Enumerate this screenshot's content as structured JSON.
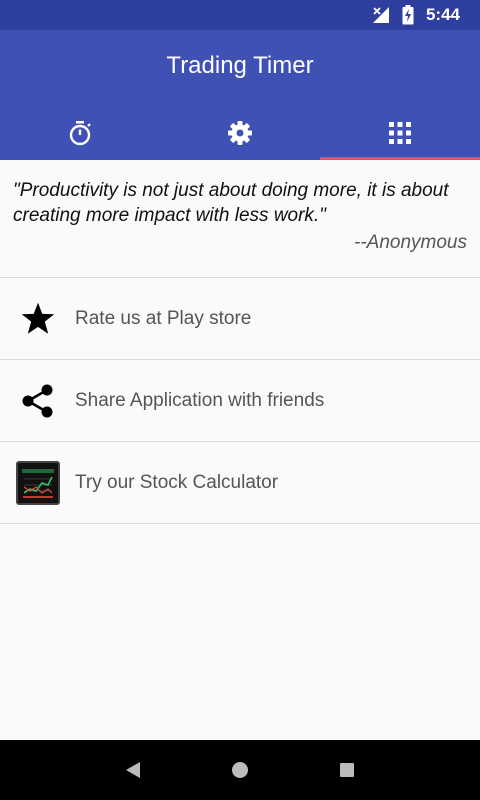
{
  "status_bar": {
    "time": "5:44"
  },
  "app_bar": {
    "title": "Trading Timer"
  },
  "tabs": [
    {
      "name": "timer",
      "icon": "stopwatch-icon"
    },
    {
      "name": "settings",
      "icon": "gear-icon"
    },
    {
      "name": "apps",
      "icon": "grid-icon",
      "active": true
    }
  ],
  "quote": {
    "text": "\"Productivity is not just about doing more, it is about creating more impact with less work.\"",
    "author": "--Anonymous"
  },
  "menu": {
    "rate_label": "Rate us at Play store",
    "share_label": "Share Application with friends",
    "calc_label": "Try our Stock Calculator"
  },
  "colors": {
    "primary": "#3f51b5",
    "primary_dark": "#2f3f9f",
    "accent": "#ff4081"
  }
}
